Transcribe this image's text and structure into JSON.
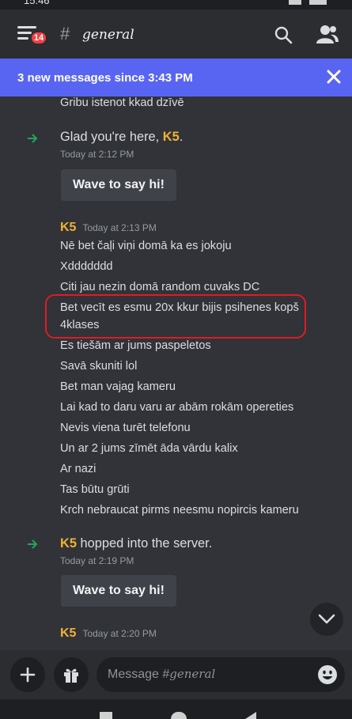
{
  "status_bar": {
    "time": "15:46"
  },
  "header": {
    "notification_count": "14",
    "channel_hash": "#",
    "channel_name": "general"
  },
  "banner": {
    "text": "3 new messages since 3:43 PM"
  },
  "messages": {
    "top_line": "Gribu istenot kkad dzīvē",
    "join1": {
      "prefix": "Glad you're here, ",
      "user": "K5",
      "suffix": ".",
      "timestamp": "Today at 2:12 PM",
      "wave_label": "Wave to say hi!"
    },
    "group": {
      "author": "K5",
      "timestamp": "Today at 2:13 PM",
      "lines": [
        "Nē bet čaļi viņi domā ka es jokoju",
        "Xddddddd",
        "Citi jau nezin domā random cuvaks DC",
        "Bet vecīt es esmu 20x kkur bijis psihenes kopš",
        "4klases",
        "Es tiešām ar jums paspeletos",
        "Savā skuniti lol",
        "Bet man vajag kameru",
        "Lai kad to daru varu ar abām rokām opereties",
        "Nevis viena turēt telefonu",
        "Un ar 2 jums zīmēt āda vārdu kalix",
        "Ar nazi",
        "Tas būtu grūti",
        "Krch nebraucat pirms neesmu nopircis kameru"
      ]
    },
    "join2": {
      "user": "K5",
      "suffix": " hopped into the server.",
      "timestamp": "Today at 2:19 PM",
      "wave_label": "Wave to say hi!"
    },
    "group2": {
      "author": "K5",
      "timestamp": "Today at 2:20 PM"
    }
  },
  "composer": {
    "placeholder_prefix": "Message #",
    "placeholder_channel": "general"
  },
  "colors": {
    "accent": "#5865f2",
    "username": "#f0b232",
    "highlight": "#e01b24",
    "join_arrow": "#23a55a"
  }
}
